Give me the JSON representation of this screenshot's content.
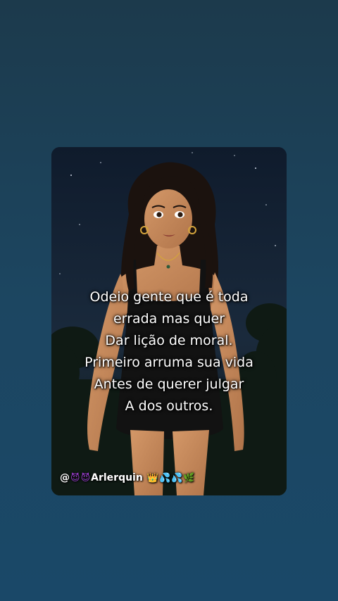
{
  "quote": {
    "lines": [
      "Odeio gente que é toda",
      "errada mas quer",
      "Dar lição de moral.",
      "Primeiro arruma sua vida",
      "Antes de querer julgar",
      "A dos outros."
    ]
  },
  "credit": {
    "at": "@",
    "name": "Arlerquin",
    "emojis": {
      "devil": "😈",
      "crown": "👑",
      "drops": "💦",
      "leaf": "🌿"
    }
  },
  "colors": {
    "background": "#1c4661",
    "card": "#152235",
    "text": "#ffffff",
    "skin": "#c98a5a",
    "dress": "#121212"
  }
}
